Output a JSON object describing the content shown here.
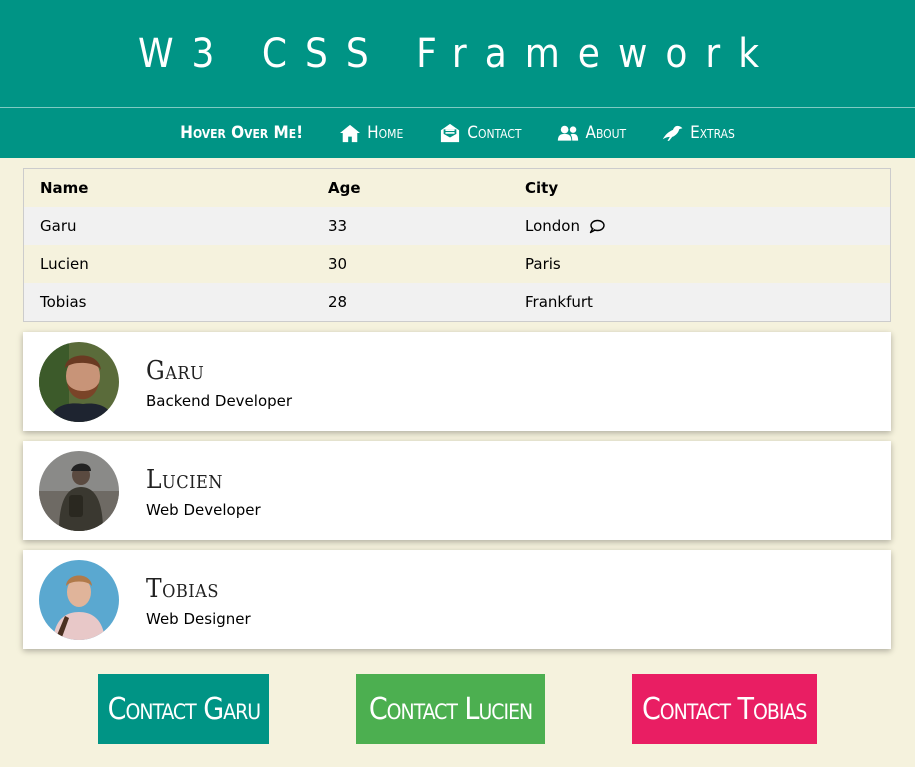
{
  "header": {
    "title": "W3 CSS Framework"
  },
  "nav": {
    "items": [
      {
        "label": "Hover Over Me!",
        "icon": ""
      },
      {
        "label": "Home",
        "icon": "home-icon"
      },
      {
        "label": "Contact",
        "icon": "envelope-open-icon"
      },
      {
        "label": "About",
        "icon": "users-icon"
      },
      {
        "label": "Extras",
        "icon": "crow-icon"
      }
    ]
  },
  "table": {
    "headers": [
      "Name",
      "Age",
      "City"
    ],
    "rows": [
      {
        "name": "Garu",
        "age": "33",
        "city": "London"
      },
      {
        "name": "Lucien",
        "age": "30",
        "city": "Paris"
      },
      {
        "name": "Tobias",
        "age": "28",
        "city": "Frankfurt"
      }
    ]
  },
  "cards": [
    {
      "name": "Garu",
      "role": "Backend Developer"
    },
    {
      "name": "Lucien",
      "role": "Web Developer"
    },
    {
      "name": "Tobias",
      "role": "Web Designer"
    }
  ],
  "buttons": [
    {
      "label": "Contact Garu",
      "color": "#009485"
    },
    {
      "label": "Contact Lucien",
      "color": "#4caf50"
    },
    {
      "label": "Contact Tobias",
      "color": "#e91e63"
    }
  ],
  "colors": {
    "primary": "#009485",
    "background": "#f5f2dd"
  }
}
